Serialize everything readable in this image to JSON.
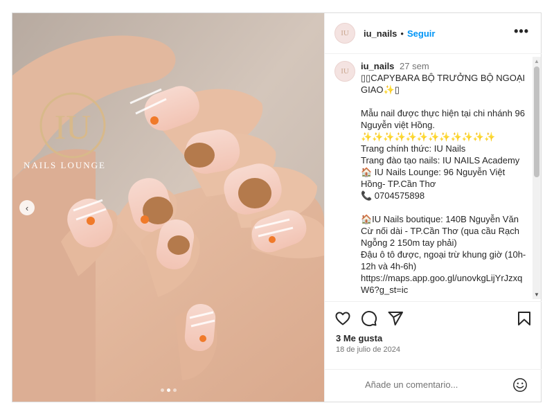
{
  "photo": {
    "logo_letters": "IU",
    "logo_caption": "NAILS LOUNGE",
    "prev_icon": "‹",
    "carousel_index": 2,
    "carousel_total": 3
  },
  "header": {
    "username": "iu_nails",
    "separator": "•",
    "follow_label": "Seguir",
    "more_icon": "•••"
  },
  "post": {
    "avatar_text": "IU",
    "username": "iu_nails",
    "time_ago": "27 sem",
    "caption_lines": [
      "▯▯CAPYBARA BỘ TRƯỞNG BỘ NGOẠI GIAO✨▯",
      "",
      "Mẫu nail được thực hiện tại chi nhánh 96 Nguyễn việt Hồng.",
      "✨✨✨✨✨✨✨✨✨✨✨✨",
      "Trang chính thức: IU Nails",
      "Trang đào tạo nails: IU NAILS Academy",
      "🏠 IU Nails Lounge: 96 Nguyễn Việt Hồng- TP.Cần Thơ",
      "📞 0704575898",
      "",
      "🏠IU Nails boutique: 140B Nguyễn Văn Cừ nối dài - TP.Cần Thơ (qua cầu Rạch Ngỗng 2 150m tay phải)",
      "Đậu ô tô được, ngoại trừ khung giờ (10h-12h và 4h-6h)",
      "https://maps.app.goo.gl/unovkgLijYrJzxqW6?g_st=ic"
    ]
  },
  "actions": {
    "like_icon": "heart-icon",
    "comment_icon": "comment-icon",
    "share_icon": "send-icon",
    "save_icon": "bookmark-icon"
  },
  "likes_text": "3 Me gusta",
  "date_text": "18 de julio de 2024",
  "comment_box": {
    "placeholder": "Añade un comentario...",
    "emoji_icon": "smiley-icon"
  },
  "colors": {
    "link_blue": "#0095f6",
    "border": "#dbdbdb",
    "muted_text": "#737373"
  }
}
